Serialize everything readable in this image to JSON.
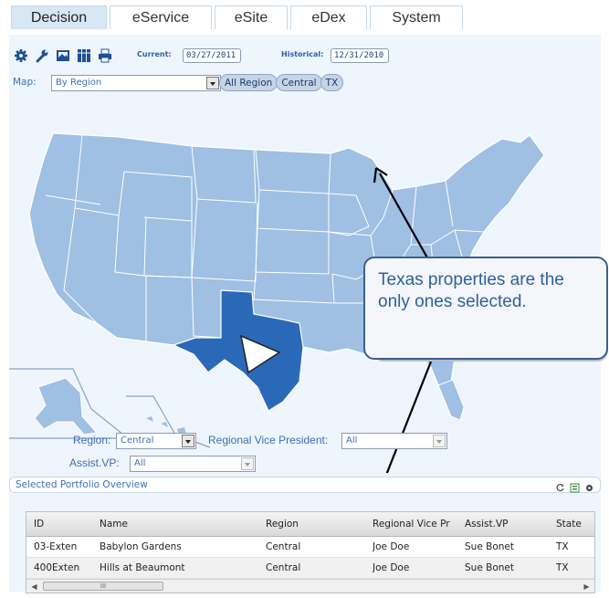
{
  "tabs": [
    {
      "label": "Decision",
      "active": true
    },
    {
      "label": "eService",
      "active": false
    },
    {
      "label": "eSite",
      "active": false
    },
    {
      "label": "eDex",
      "active": false
    },
    {
      "label": "System",
      "active": false
    }
  ],
  "toolbar": {
    "icons": [
      "gear-icon",
      "wrench-icon",
      "image-icon",
      "grid-icon",
      "print-icon"
    ],
    "current_label": "Current:",
    "current_value": "03/27/2011",
    "historical_label": "Historical:",
    "historical_value": "12/31/2010"
  },
  "map_control": {
    "label": "Map:",
    "selected": "By Region"
  },
  "breadcrumbs": [
    "All Region",
    "Central",
    "TX"
  ],
  "callout": {
    "text": "Texas properties are the only ones selected."
  },
  "filters": {
    "region_label": "Region:",
    "region_value": "Central",
    "rvp_label": "Regional Vice President:",
    "rvp_value": "All",
    "avp_label": "Assist.VP:",
    "avp_value": "All"
  },
  "overview": {
    "title": "Selected Portfolio Overview",
    "icons": [
      "refresh-icon",
      "export-icon",
      "settings-icon"
    ]
  },
  "table": {
    "columns": [
      "ID",
      "Name",
      "Region",
      "Regional Vice Pr",
      "Assist.VP",
      "State"
    ],
    "rows": [
      [
        "03-Exten",
        "Babylon Gardens",
        "Central",
        "Joe Doe",
        "Sue Bonet",
        "TX"
      ],
      [
        "400Exten",
        "Hills at Beaumont",
        "Central",
        "Joe Doe",
        "Sue Bonet",
        "TX"
      ]
    ],
    "scroll_thumb": "III"
  },
  "colors": {
    "panel_bg": "#eef5fc",
    "state_fill": "#9fbfe3",
    "selected_state": "#2a69b8",
    "accent_text": "#3d6fb6",
    "arrow": "#000000"
  }
}
